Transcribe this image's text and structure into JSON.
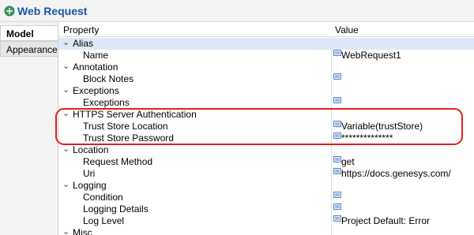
{
  "window": {
    "title": "Web Request"
  },
  "tabs": [
    {
      "label": "Model"
    },
    {
      "label": "Appearance"
    }
  ],
  "table": {
    "columns": [
      "Property",
      "Value"
    ]
  },
  "groups": {
    "alias": {
      "label": "Alias",
      "rows": [
        {
          "name": "Name",
          "value": "WebRequest1"
        }
      ]
    },
    "annotation": {
      "label": "Annotation",
      "rows": [
        {
          "name": "Block Notes",
          "value": ""
        }
      ]
    },
    "exceptions": {
      "label": "Exceptions",
      "rows": [
        {
          "name": "Exceptions",
          "value": ""
        }
      ]
    },
    "https": {
      "label": "HTTPS Server Authentication",
      "rows": [
        {
          "name": "Trust Store Location",
          "value": "Variable(trustStore)"
        },
        {
          "name": "Trust Store Password",
          "value": "**************"
        }
      ]
    },
    "location": {
      "label": "Location",
      "rows": [
        {
          "name": "Request Method",
          "value": "get"
        },
        {
          "name": "Uri",
          "value": "https://docs.genesys.com/"
        }
      ]
    },
    "logging": {
      "label": "Logging",
      "rows": [
        {
          "name": "Condition",
          "value": ""
        },
        {
          "name": "Logging Details",
          "value": ""
        },
        {
          "name": "Log Level",
          "value": "Project Default: Error"
        }
      ]
    },
    "misc": {
      "label": "Misc"
    }
  },
  "colors": {
    "title": "#1a56a8",
    "selected_row": "#dbe9f7",
    "highlight_ring": "#e02020"
  },
  "icons": {
    "title": "web-request-icon",
    "value": "value-editor-icon",
    "expander": "chevron-down-icon"
  }
}
